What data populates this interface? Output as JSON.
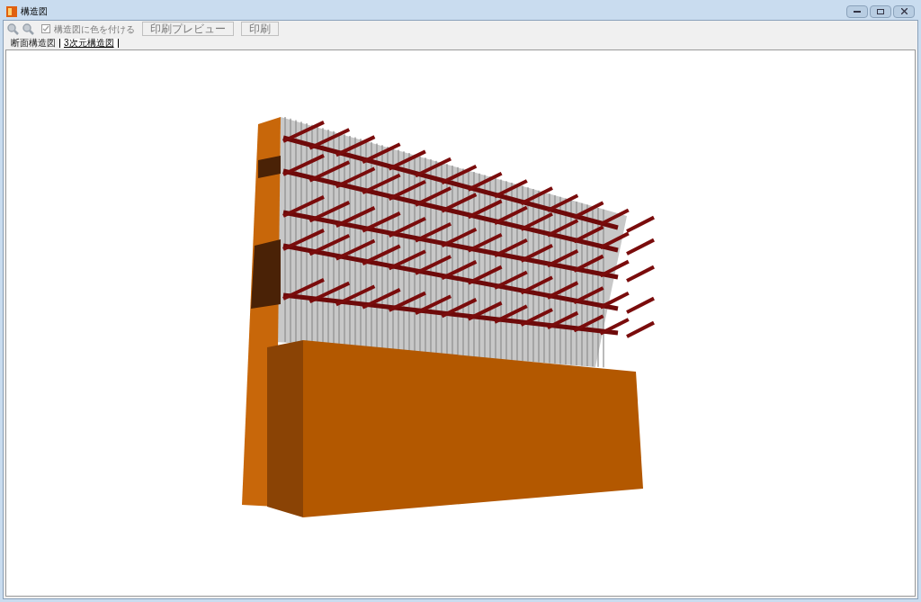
{
  "window": {
    "title": "構造図"
  },
  "toolbar": {
    "zoom_in": {
      "disabled": true
    },
    "zoom_out": {
      "disabled": true
    },
    "color_checkbox": {
      "label": "構造図に色を付ける",
      "checked": true,
      "disabled": true
    },
    "buttons": [
      {
        "label": "印刷プレビュー",
        "disabled": true
      },
      {
        "label": "印刷",
        "disabled": true
      }
    ]
  },
  "tabs": [
    {
      "label": "断面構造図",
      "selected": false
    },
    {
      "label": "3次元構造図",
      "selected": true
    }
  ]
}
